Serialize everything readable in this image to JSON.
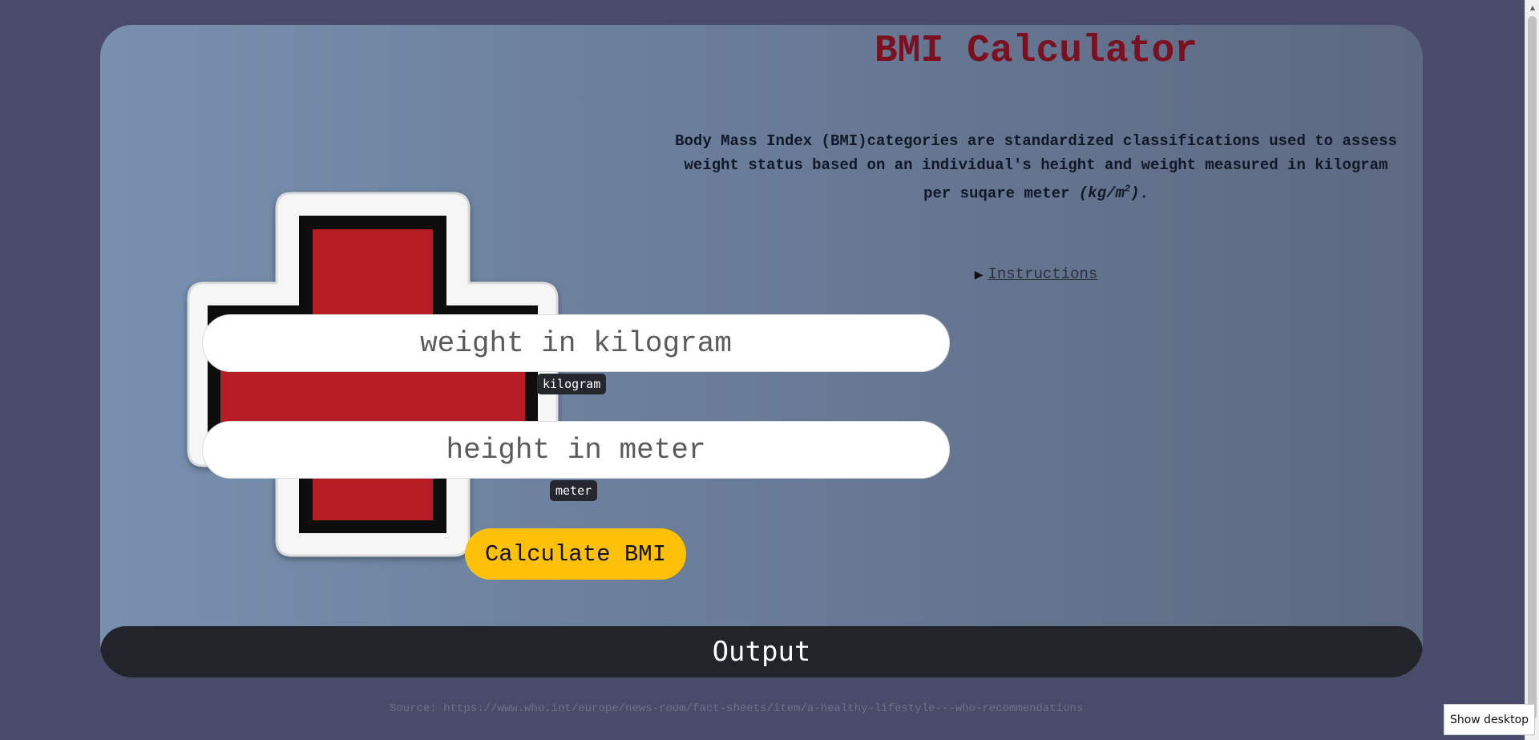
{
  "app": {
    "title": "BMI Calculator",
    "description_main": "Body Mass Index (BMI)categories are standardized classifications used to assess weight status based on an individual's height and weight measured in kilogram per suqare meter ",
    "description_unit": "(kg/m",
    "description_unit_sup": "2",
    "description_unit_close": ")",
    "description_end": "."
  },
  "instructions": {
    "label": "Instructions"
  },
  "form": {
    "weight_placeholder": "weight in kilogram",
    "weight_value": "",
    "weight_badge": "kilogram",
    "height_placeholder": "height in meter",
    "height_value": "",
    "height_badge": "meter",
    "calculate_label": "Calculate BMI"
  },
  "output": {
    "label": "Output"
  },
  "footer": {
    "source": "Source: https://www.who.int/europe/news-room/fact-sheets/item/a-healthy-lifestyle---who-recommendations"
  },
  "taskbar": {
    "show_desktop": "Show desktop"
  },
  "icons": {
    "logo": "red-cross-icon",
    "disclosure": "triangle-right-icon"
  },
  "colors": {
    "title": "#7a1020",
    "button": "#ffc107",
    "output_bar": "#212429",
    "cross_red": "#b71c24"
  }
}
